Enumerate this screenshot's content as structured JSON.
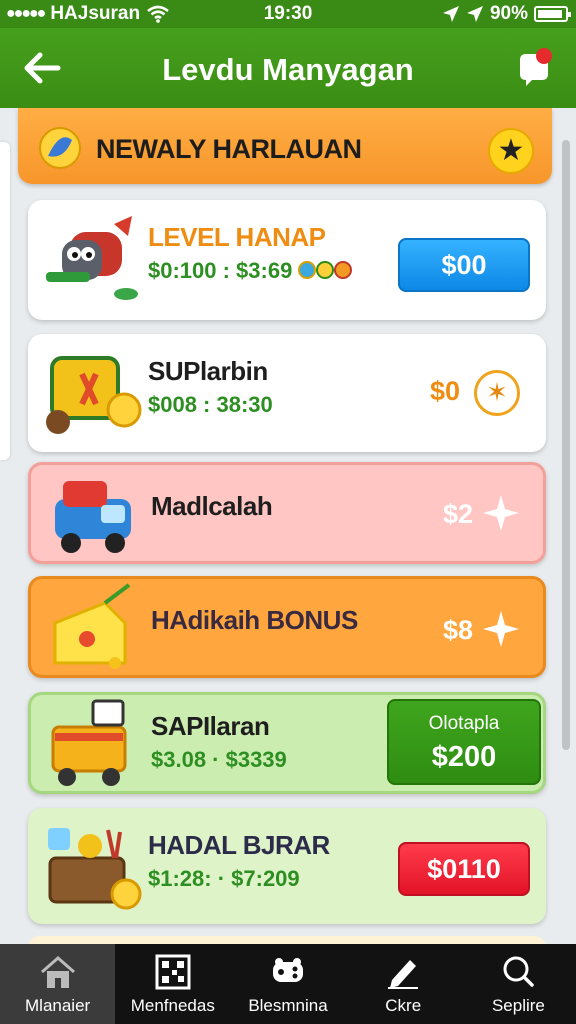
{
  "status": {
    "carrier": "HAJsuran",
    "time": "19:30",
    "battery": "90%"
  },
  "header": {
    "title": "Levdu Manyagan"
  },
  "banner": {
    "title": "NEWALY HARLAUAN"
  },
  "items": [
    {
      "title": "LEVEL HANAP",
      "sub": "$0:100 : $3:69",
      "price": "$00",
      "action": "button-blue"
    },
    {
      "title": "SUPlarbin",
      "sub": "$008 : 38:30",
      "price": "$0",
      "action": "circle"
    },
    {
      "title": "Madlcalah",
      "sub": "",
      "price": "$2",
      "action": "sparkle"
    },
    {
      "title": "HAdikaih BONUS",
      "sub": "",
      "price": "$8",
      "action": "sparkle"
    },
    {
      "title": "SAPIlaran",
      "sub": "$3.08 · $3339",
      "price_label": "Olotapla",
      "price": "$200",
      "action": "button-green"
    },
    {
      "title": "HADAL BJRAR",
      "sub": "$1:28: · $7:209",
      "price": "$0110",
      "action": "button-red"
    }
  ],
  "nav": [
    {
      "label": "Mlanaier",
      "icon": "home-icon",
      "active": true
    },
    {
      "label": "Menfnedas",
      "icon": "qr-grid-icon",
      "active": false
    },
    {
      "label": "Blesmnina",
      "icon": "game-controller-icon",
      "active": false
    },
    {
      "label": "Ckre",
      "icon": "edit-icon",
      "active": false
    },
    {
      "label": "Seplire",
      "icon": "search-icon",
      "active": false
    }
  ]
}
